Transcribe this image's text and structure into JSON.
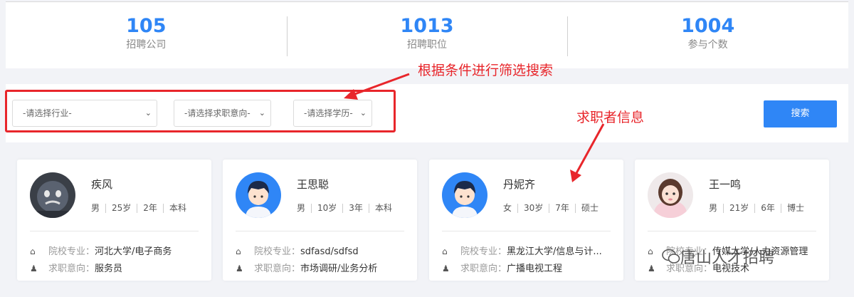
{
  "stats": [
    {
      "value": "105",
      "label": "招聘公司"
    },
    {
      "value": "1013",
      "label": "招聘职位"
    },
    {
      "value": "1004",
      "label": "参与个数"
    }
  ],
  "filters": {
    "industry": "-请选择行业-",
    "intention": "-请选择求职意向-",
    "education": "-请选择学历-",
    "search_label": "搜索"
  },
  "annotations": {
    "filter_note": "根据条件进行筛选搜索",
    "candidate_note": "求职者信息"
  },
  "candidates": [
    {
      "name": "疾风",
      "gender": "男",
      "age": "25岁",
      "experience": "2年",
      "degree": "本科",
      "school_label": "院校专业：",
      "school": "河北大学/电子商务",
      "intent_label": "求职意向：",
      "intent": "服务员"
    },
    {
      "name": "王思聪",
      "gender": "男",
      "age": "10岁",
      "experience": "3年",
      "degree": "本科",
      "school_label": "院校专业：",
      "school": "sdfasd/sdfsd",
      "intent_label": "求职意向：",
      "intent": "市场调研/业务分析"
    },
    {
      "name": "丹妮齐",
      "gender": "女",
      "age": "30岁",
      "experience": "7年",
      "degree": "硕士",
      "school_label": "院校专业：",
      "school": "黑龙江大学/信息与计...",
      "intent_label": "求职意向：",
      "intent": "广播电视工程"
    },
    {
      "name": "王一鸣",
      "gender": "男",
      "age": "21岁",
      "experience": "6年",
      "degree": "博士",
      "school_label": "院校专业：",
      "school": "传媒大学/人力资源管理",
      "intent_label": "求职意向：",
      "intent": "电视技术"
    }
  ],
  "watermark": {
    "text": "唐山人才招聘"
  },
  "icons": {
    "school": "home-icon",
    "intent": "person-icon"
  },
  "colors": {
    "accent": "#2f86f6",
    "annotation": "#e8262b"
  }
}
